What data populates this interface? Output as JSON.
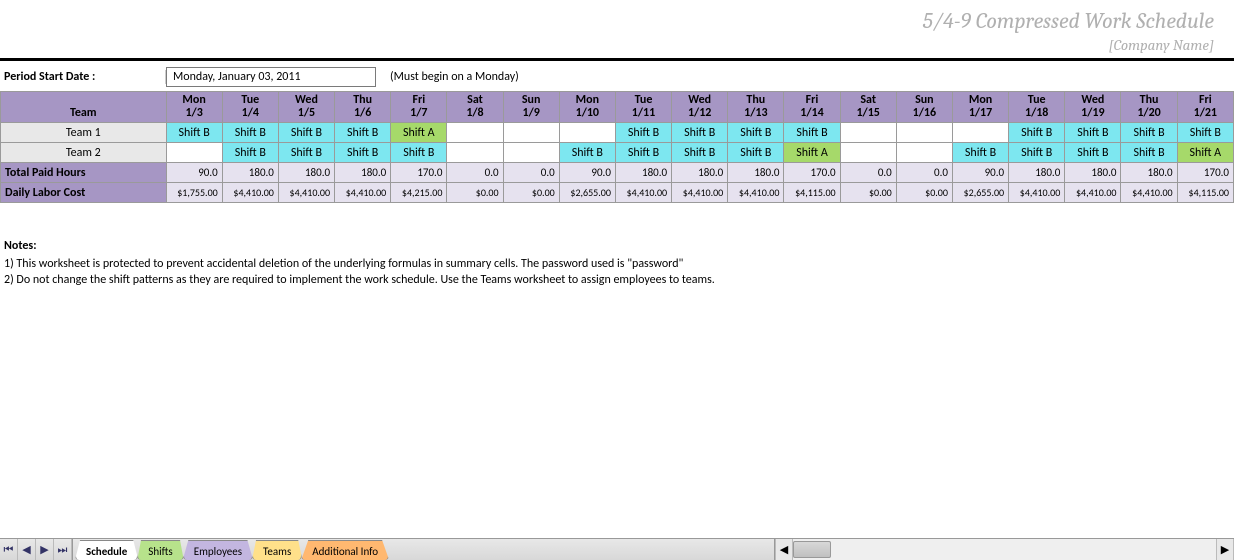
{
  "header": {
    "title": "5/4-9 Compressed Work Schedule",
    "subtitle": "[Company Name]"
  },
  "period": {
    "label": "Period Start Date :",
    "value": "Monday, January 03, 2011",
    "note": "(Must begin on a Monday)"
  },
  "columns": {
    "team_label": "Team",
    "days": [
      {
        "dow": "Mon",
        "date": "1/3"
      },
      {
        "dow": "Tue",
        "date": "1/4"
      },
      {
        "dow": "Wed",
        "date": "1/5"
      },
      {
        "dow": "Thu",
        "date": "1/6"
      },
      {
        "dow": "Fri",
        "date": "1/7"
      },
      {
        "dow": "Sat",
        "date": "1/8"
      },
      {
        "dow": "Sun",
        "date": "1/9"
      },
      {
        "dow": "Mon",
        "date": "1/10"
      },
      {
        "dow": "Tue",
        "date": "1/11"
      },
      {
        "dow": "Wed",
        "date": "1/12"
      },
      {
        "dow": "Thu",
        "date": "1/13"
      },
      {
        "dow": "Fri",
        "date": "1/14"
      },
      {
        "dow": "Sat",
        "date": "1/15"
      },
      {
        "dow": "Sun",
        "date": "1/16"
      },
      {
        "dow": "Mon",
        "date": "1/17"
      },
      {
        "dow": "Tue",
        "date": "1/18"
      },
      {
        "dow": "Wed",
        "date": "1/19"
      },
      {
        "dow": "Thu",
        "date": "1/20"
      },
      {
        "dow": "Fri",
        "date": "1/21"
      }
    ]
  },
  "teams": [
    {
      "name": "Team 1",
      "shifts": [
        "Shift B",
        "Shift B",
        "Shift B",
        "Shift B",
        "Shift A",
        "",
        "",
        "",
        "Shift B",
        "Shift B",
        "Shift B",
        "Shift B",
        "",
        "",
        "",
        "Shift B",
        "Shift B",
        "Shift B",
        "Shift B"
      ]
    },
    {
      "name": "Team 2",
      "shifts": [
        "",
        "Shift B",
        "Shift B",
        "Shift B",
        "Shift B",
        "",
        "",
        "Shift B",
        "Shift B",
        "Shift B",
        "Shift B",
        "Shift A",
        "",
        "",
        "Shift B",
        "Shift B",
        "Shift B",
        "Shift B",
        "Shift A"
      ]
    }
  ],
  "summary": {
    "hours_label": "Total Paid Hours",
    "hours": [
      "90.0",
      "180.0",
      "180.0",
      "180.0",
      "170.0",
      "0.0",
      "0.0",
      "90.0",
      "180.0",
      "180.0",
      "180.0",
      "170.0",
      "0.0",
      "0.0",
      "90.0",
      "180.0",
      "180.0",
      "180.0",
      "170.0"
    ],
    "cost_label": "Daily Labor Cost",
    "cost": [
      "$1,755.00",
      "$4,410.00",
      "$4,410.00",
      "$4,410.00",
      "$4,215.00",
      "$0.00",
      "$0.00",
      "$2,655.00",
      "$4,410.00",
      "$4,410.00",
      "$4,410.00",
      "$4,115.00",
      "$0.00",
      "$0.00",
      "$2,655.00",
      "$4,410.00",
      "$4,410.00",
      "$4,410.00",
      "$4,115.00"
    ]
  },
  "notes": {
    "title": "Notes:",
    "lines": [
      "1) This worksheet is protected to prevent accidental deletion of the underlying formulas in summary cells. The password used is \"password\"",
      "2) Do not change the shift patterns as they are required to implement the work schedule.  Use the Teams worksheet to assign employees to teams."
    ]
  },
  "sheets": {
    "tabs": [
      {
        "label": "Schedule",
        "color": "active"
      },
      {
        "label": "Shifts",
        "color": "c-green"
      },
      {
        "label": "Employees",
        "color": "c-purple"
      },
      {
        "label": "Teams",
        "color": "c-yellow"
      },
      {
        "label": "Additional Info",
        "color": "c-orange"
      }
    ]
  }
}
